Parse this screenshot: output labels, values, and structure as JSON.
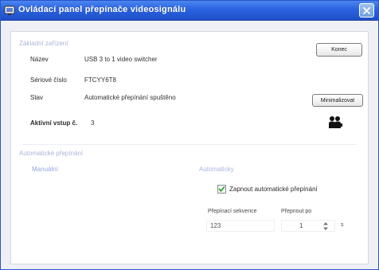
{
  "window": {
    "title": "Ovládací panel přepínače videosignálu",
    "icon": "app-icon",
    "close_icon": "help-icon"
  },
  "basic_info": {
    "section_title": "Základní zařízení",
    "name_label": "Název",
    "name_value": "USB 3 to 1 video switcher",
    "serial_label": "Sériové číslo",
    "serial_value": "FTCYY6T8",
    "status_label": "Stav",
    "status_value": "Automatické přepínání spuštěno",
    "active_input_label": "Aktivní vstup č.",
    "active_input_value": "3",
    "exit_button": "Konec",
    "minimize_button": "Minimalizovat",
    "active_icon": "people-camera-icon"
  },
  "switching": {
    "section_title": "Automatické přepínání",
    "manual_link": "Manuální",
    "auto_label": "Automaticky",
    "auto_checkbox_label": "Zapnout automatické přepínání",
    "auto_checked": true,
    "sequence_label": "Přepínací sekvence",
    "sequence_value": "123",
    "interval_label": "Přepnout po",
    "interval_value": "1",
    "interval_unit": "s"
  },
  "colors": {
    "titlebar": "#2a62e0",
    "section_title": "#a8b5d8",
    "link": "#8fa8dc"
  }
}
